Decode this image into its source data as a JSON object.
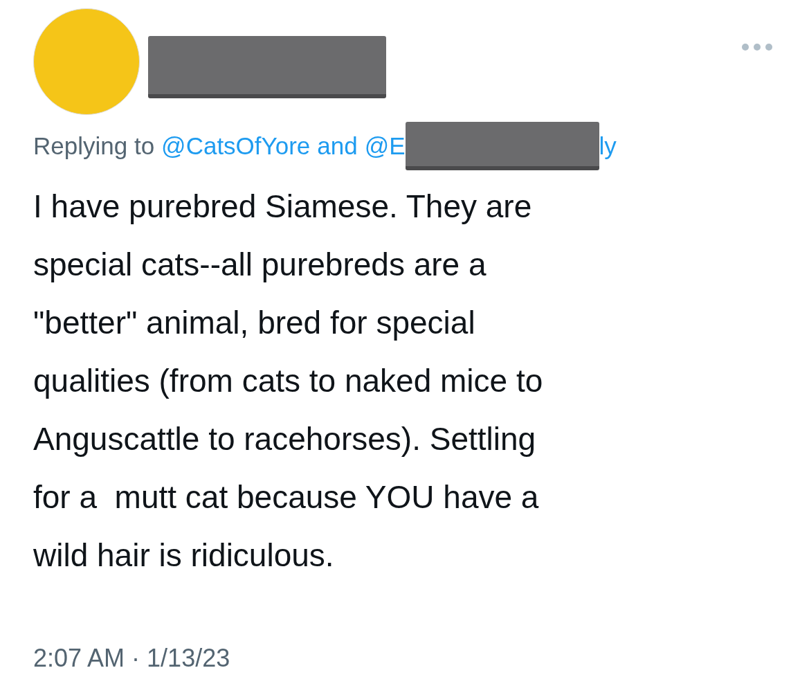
{
  "tweet": {
    "author_redacted": true,
    "reply": {
      "prefix": "Replying to",
      "mentions": [
        "@CatsOfYore",
        "@E"
      ],
      "joiner": "and",
      "mention_tail": "ly",
      "tail_redacted": true
    },
    "body_lines": [
      "I have purebred Siamese. They are",
      "special cats--all purebreds are a",
      "\"better\" animal, bred for special",
      "qualities (from cats to naked mice to",
      "Anguscattle to racehorses). Settling",
      "for a  mutt cat because YOU have a",
      "wild hair is ridiculous."
    ],
    "time": "2:07 AM",
    "separator": "·",
    "date": "1/13/23"
  }
}
